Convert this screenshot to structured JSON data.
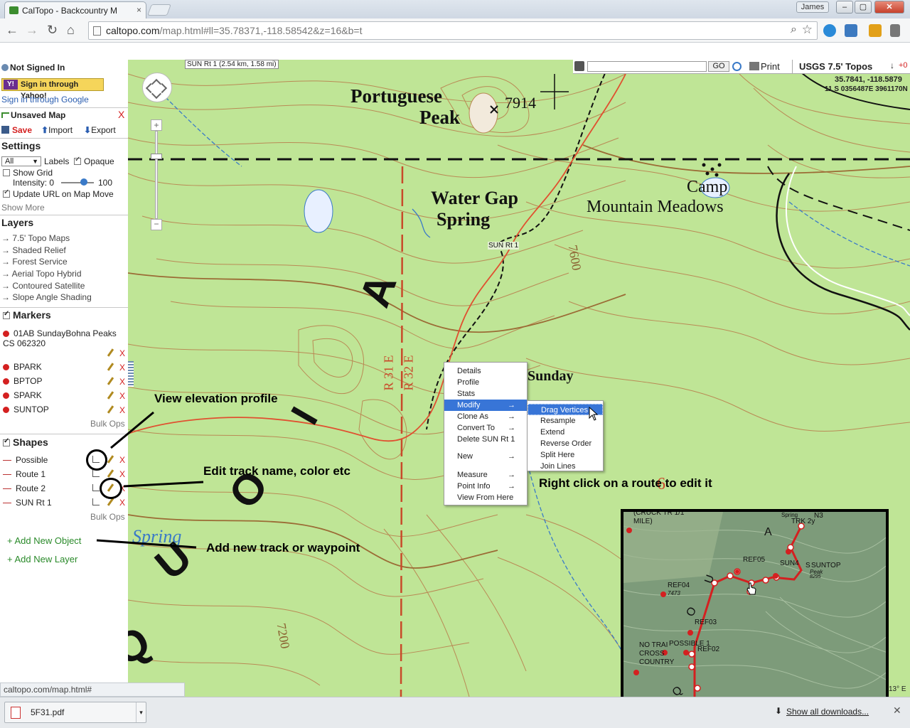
{
  "browser": {
    "tab_title": "CalTopo - Backcountry M",
    "tab_close": "×",
    "user_name": "James",
    "url_domain": "caltopo.com",
    "url_path": "/map.html#ll=35.78371,-118.58542&z=16&b=t",
    "win_min": "–",
    "win_max": "▢",
    "win_close": "✕",
    "back_glyph": "←",
    "forward_glyph": "→",
    "reload_glyph": "↻",
    "home_glyph": "⌂",
    "search_glyph": "⌕",
    "star_glyph": "☆"
  },
  "map_toolbar": {
    "route_readout": "SUN Rt 1 (2.54 km, 1.58 mi)",
    "go_label": "GO",
    "print_label": "Print",
    "layer_name": "USGS 7.5' Topos",
    "arrows": "↓",
    "plus_zero": "+0",
    "coords": "35.7841, -118.5879",
    "utm": "11 S 0356487E 3961170N",
    "scale_label": "13° E"
  },
  "map_labels": {
    "portuguese": "Portuguese",
    "peak": "Peak",
    "elevation": "7914",
    "water_gap": "Water Gap",
    "spring": "Spring",
    "camp": "Camp",
    "mountain_meadows": "Mountain Meadows",
    "route_tag": "SUN Rt 1",
    "contour_7600": "7600",
    "contour_7200": "7200",
    "r31e": "R 31 E",
    "r32e": "R 32 E",
    "digit_6": "6",
    "big_a": "A",
    "big_i": "I",
    "big_o": "O",
    "big_u": "U",
    "big_q": "Q",
    "spring_lower": "Spring",
    "sunday_partial": "Sunday"
  },
  "sidebar": {
    "not_signed_in": "Not Signed In",
    "yahoo": "Sign in through Yahoo!",
    "google": "Sign in through Google",
    "unsaved_map": "Unsaved Map",
    "close_x": "X",
    "save": "Save",
    "import": "Import",
    "export": "Export",
    "settings": "Settings",
    "select_value": "All",
    "labels": "Labels",
    "opaque": "Opaque",
    "show_grid": "Show Grid",
    "intensity": "Intensity: 0",
    "intensity_max": "100",
    "intensity_level": 0.7,
    "update_url": "Update URL on Map Move",
    "show_more": "Show More",
    "layers": "Layers",
    "layer_items": [
      "→ 7.5' Topo Maps",
      "→ Shaded Relief",
      "→ Forest Service",
      "→ Aerial Topo Hybrid",
      "→ Contoured Satellite",
      "→ Slope Angle Shading"
    ],
    "markers": "Markers",
    "marker_items": [
      "01AB SundayBohna Peaks CS 062320",
      "BPARK",
      "BPTOP",
      "SPARK",
      "SUNTOP"
    ],
    "bulk_ops": "Bulk Ops",
    "shapes": "Shapes",
    "shape_items": [
      "Possible",
      "Route 1",
      "Route 2",
      "SUN Rt 1"
    ],
    "add_object": "+ Add New Object",
    "add_layer": "+ Add New Layer"
  },
  "context_menu": {
    "items": [
      "Details",
      "Profile",
      "Stats",
      "Modify",
      "Clone As",
      "Convert To",
      "Delete SUN Rt 1",
      "New",
      "Measure",
      "Point Info",
      "View From Here"
    ],
    "arrow": "→",
    "submenu": [
      "Drag Vertices",
      "Resample",
      "Extend",
      "Reverse Order",
      "Split Here",
      "Join Lines"
    ]
  },
  "annotations": {
    "profile": "View elevation profile",
    "edit": "Edit track name, color etc",
    "right_click": "Right click on a route to edit it",
    "add_new": "Add new track or waypoint"
  },
  "inset": {
    "top_left": "(CRUCK TR 1/1",
    "mile": "MILE)",
    "trk2": "TRK 2y",
    "n3": "N3",
    "spring": "Spring",
    "ref05": "REF05",
    "sun4": "SUN4",
    "s": "S",
    "suntop": "SUNTOP",
    "peak": "Peak",
    "peak_el": "8295",
    "ref04": "REF04",
    "el_7473": "7473",
    "ref03": "REF03",
    "possible1": "POSSIBLE 1",
    "ref02": "REF02",
    "no_trail": "NO TRAI",
    "cross": "CROSS",
    "country": "COUNTRY",
    "letter_a": "A",
    "letter_u": "U",
    "letter_o": "O",
    "letter_q": "Q"
  },
  "status": {
    "hover_url": "caltopo.com/map.html#",
    "download_name": "5F31.pdf",
    "show_all": "Show all downloads...",
    "close": "✕",
    "caret": "▾"
  }
}
